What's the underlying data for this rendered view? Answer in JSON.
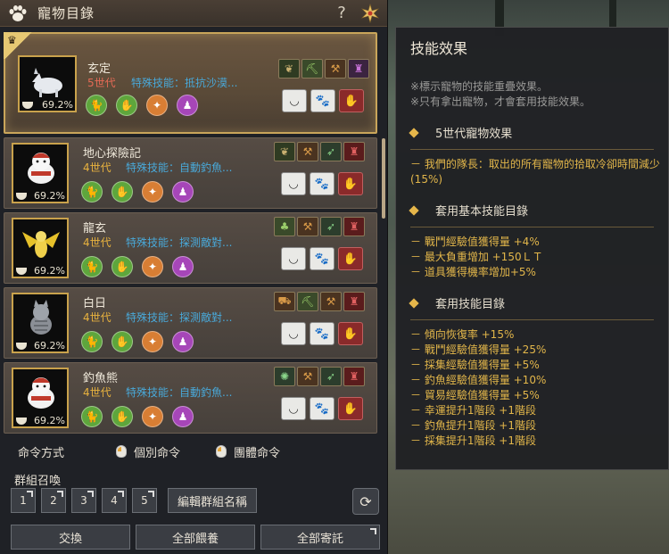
{
  "window": {
    "title": "寵物目錄",
    "help_label": "?"
  },
  "pets": [
    {
      "name": "玄定",
      "generation": "5世代",
      "skill": "特殊技能：抵抗沙漠...",
      "percent": "69.2%",
      "selected": true,
      "skill_icons": [
        "seed",
        "pickaxe",
        "dig",
        "bag"
      ],
      "animal": "wolf"
    },
    {
      "name": "地心探險記",
      "generation": "4世代",
      "skill": "特殊技能：自動釣魚...",
      "percent": "69.2%",
      "selected": false,
      "skill_icons": [
        "seed",
        "dig",
        "wing",
        "bag-red"
      ],
      "animal": "polar-bear"
    },
    {
      "name": "龍玄",
      "generation": "4世代",
      "skill": "特殊技能：探測敵對...",
      "percent": "69.2%",
      "selected": false,
      "skill_icons": [
        "clover",
        "dig",
        "wing",
        "pair-red"
      ],
      "animal": "dragon"
    },
    {
      "name": "白日",
      "generation": "4世代",
      "skill": "特殊技能：探測敵對...",
      "percent": "69.2%",
      "selected": false,
      "skill_icons": [
        "cart",
        "pickaxe",
        "dig",
        "bag-red"
      ],
      "animal": "cat"
    },
    {
      "name": "釣魚熊",
      "generation": "4世代",
      "skill": "特殊技能：自動釣魚...",
      "percent": "69.2%",
      "selected": false,
      "skill_icons": [
        "fish",
        "dig",
        "wing",
        "bag-red"
      ],
      "animal": "polar-bear"
    }
  ],
  "commands": {
    "label": "命令方式",
    "individual": "個別命令",
    "group": "團體命令"
  },
  "group_summon": {
    "label": "群組召喚",
    "slots": [
      "1",
      "2",
      "3",
      "4",
      "5"
    ],
    "edit_label": "編輯群組名稱"
  },
  "bottom_buttons": {
    "exchange": "交換",
    "feed_all": "全部餵養",
    "entrust_all": "全部寄託"
  },
  "tooltip": {
    "title": "技能效果",
    "notes": [
      "※標示寵物的技能重疊效果。",
      "※只有拿出寵物，才會套用技能效果。"
    ],
    "sections": [
      {
        "heading": "5世代寵物效果",
        "effects": [
          "－ 我們的隊長：取出的所有寵物的拾取冷卻時間減少(15%)"
        ]
      },
      {
        "heading": "套用基本技能目錄",
        "effects": [
          "－ 戰鬥經驗值獲得量 +4%",
          "－ 最大負重增加 +150ＬＴ",
          "－ 道具獲得機率增加+5%"
        ]
      },
      {
        "heading": "套用技能目錄",
        "effects": [
          "－ 傾向恢復率 +15%",
          "－ 戰鬥經驗值獲得量 +25%",
          "－ 採集經驗值獲得量 +5%",
          "－ 釣魚經驗值獲得量 +10%",
          "－ 貿易經驗值獲得量 +5%",
          "－ 幸運提升1階段 +1階段",
          "－ 釣魚提升1階段 +1階段",
          "－ 採集提升1階段 +1階段"
        ]
      }
    ]
  },
  "colors": {
    "accent_gold": "#c9a55a",
    "generation_5": "#e46a55",
    "generation_4": "#e8b23e",
    "skill_blue": "#49a8d8",
    "effect_text": "#e2b64a"
  }
}
